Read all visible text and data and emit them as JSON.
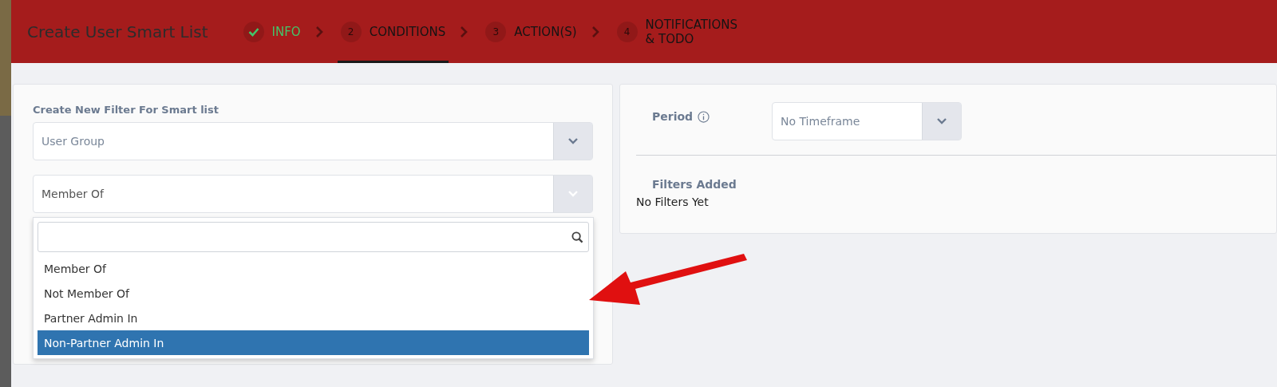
{
  "header": {
    "title": "Create User Smart List",
    "steps": [
      {
        "label": "INFO",
        "done": true,
        "selected": false
      },
      {
        "number": "2",
        "label": "CONDITIONS",
        "done": false,
        "selected": true
      },
      {
        "number": "3",
        "label": "ACTION(S)",
        "done": false,
        "selected": false
      },
      {
        "number": "4",
        "label": "NOTIFICATIONS\n& TODO",
        "done": false,
        "selected": false
      }
    ]
  },
  "filter_panel": {
    "heading": "Create New Filter For Smart list",
    "filter_select": {
      "value": "User Group"
    },
    "operator_select": {
      "value": "Member Of",
      "expanded": true
    },
    "dropdown": {
      "options": [
        {
          "label": "Member Of",
          "selected": false
        },
        {
          "label": "Not Member Of",
          "selected": false
        },
        {
          "label": "Partner Admin In",
          "selected": false
        },
        {
          "label": "Non-Partner Admin In",
          "selected": true
        }
      ]
    }
  },
  "summary_panel": {
    "period_label": "Period",
    "period_select": {
      "value": "No Timeframe"
    },
    "filters_heading": "Filters Added",
    "filters_empty": "No Filters Yet"
  }
}
